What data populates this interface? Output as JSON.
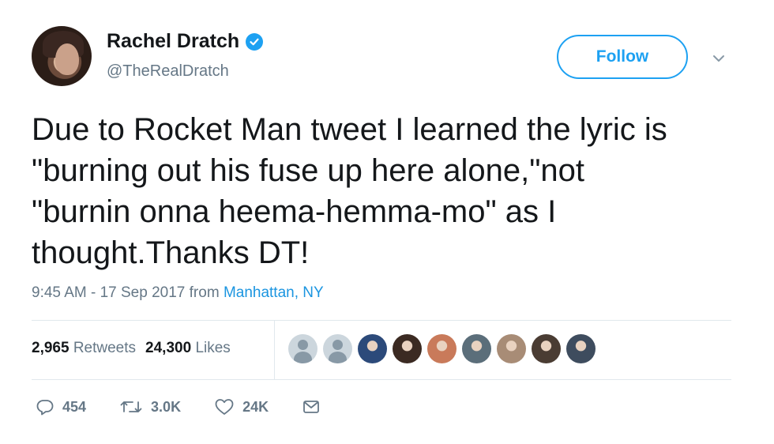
{
  "author": {
    "name": "Rachel Dratch",
    "handle": "@TheRealDratch",
    "verified": true
  },
  "follow_button": {
    "label": "Follow"
  },
  "tweet": {
    "text": "Due to Rocket Man tweet I learned the lyric is\n\"burning out his fuse up here alone,\"not\n\"burnin onna heema-hemma-mo\" as I\nthought.Thanks DT!",
    "time": "9:45 AM - 17 Sep 2017",
    "from_label": "from",
    "location": "Manhattan, NY"
  },
  "stats": {
    "retweets_count": "2,965",
    "retweets_label": "Retweets",
    "likes_count": "24,300",
    "likes_label": "Likes"
  },
  "likers": [
    {
      "type": "default"
    },
    {
      "type": "default"
    },
    {
      "type": "photo",
      "color": "#2c4a7a"
    },
    {
      "type": "photo",
      "color": "#3b2a22"
    },
    {
      "type": "photo",
      "color": "#c97a5a"
    },
    {
      "type": "photo",
      "color": "#5b6e7a"
    },
    {
      "type": "photo",
      "color": "#a88c76"
    },
    {
      "type": "photo",
      "color": "#4a3c33"
    },
    {
      "type": "photo",
      "color": "#3e4c5e"
    }
  ],
  "actions": {
    "replies": "454",
    "retweets": "3.0K",
    "likes": "24K"
  },
  "colors": {
    "accent": "#1da1f2",
    "link": "#1b95e0",
    "muted": "#657786"
  }
}
